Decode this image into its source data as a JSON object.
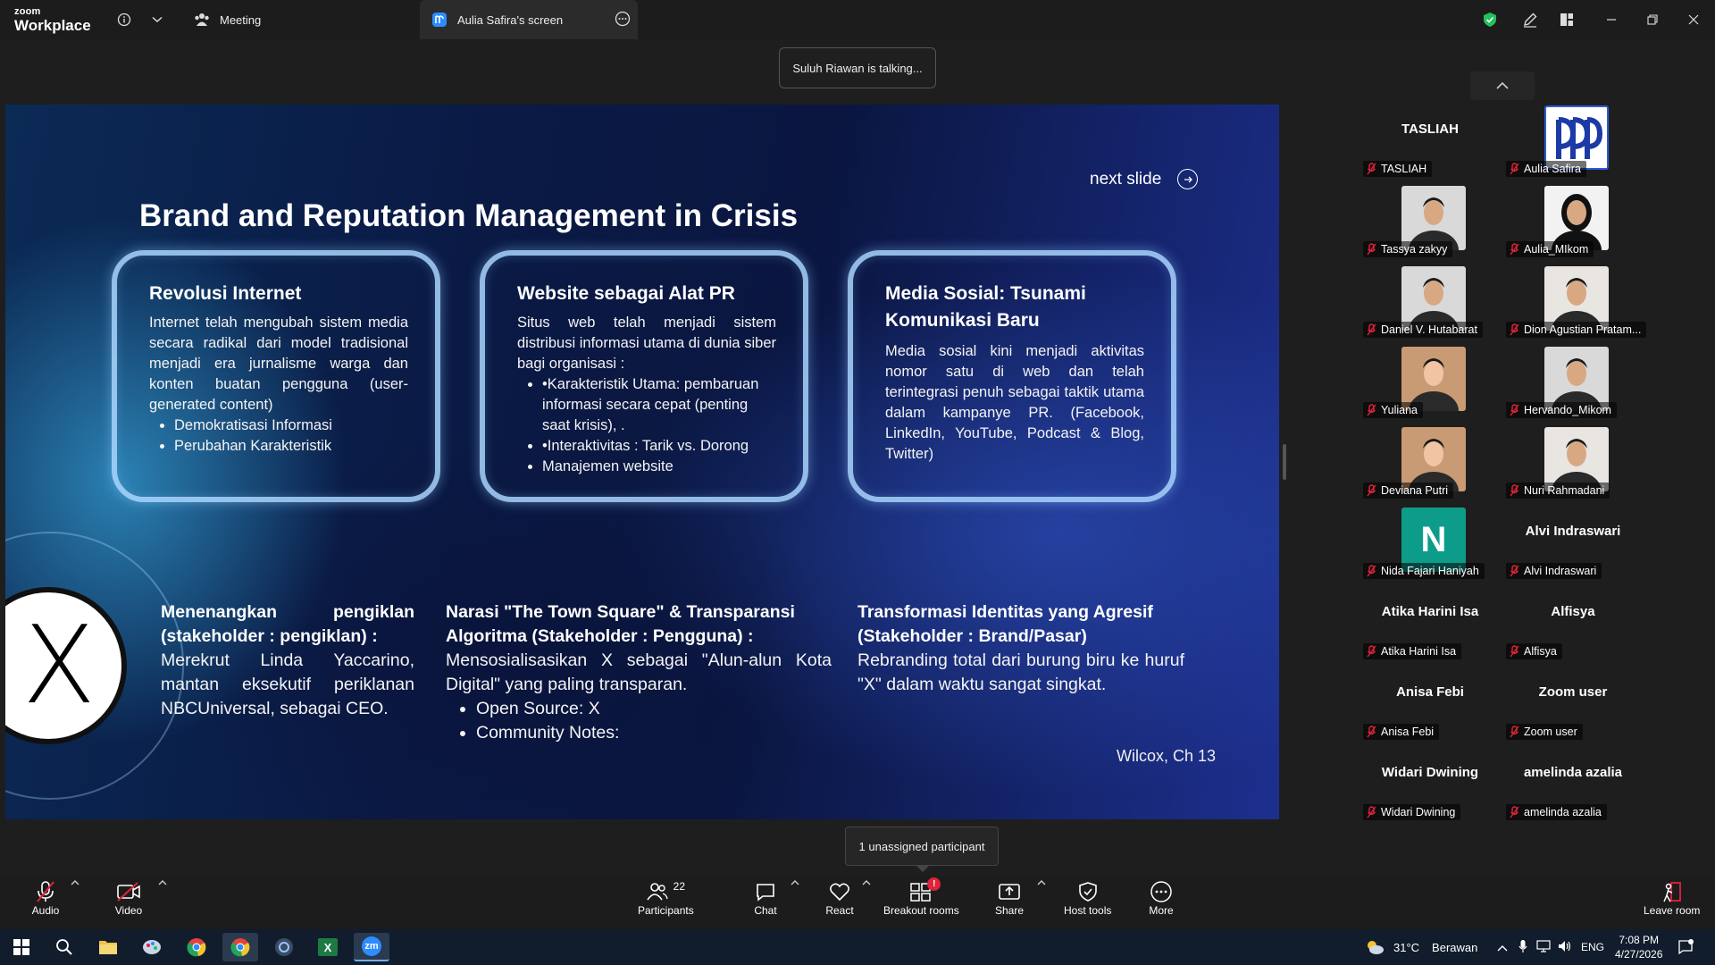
{
  "app": {
    "brand_small": "zoom",
    "brand_big": "Workplace",
    "tab_meeting": "Meeting",
    "tab_screen": "Aulia Safira's screen"
  },
  "stage": {
    "talking": "Suluh Riawan is talking...",
    "unassigned": "1 unassigned participant"
  },
  "slide": {
    "title": "Brand and Reputation Management in Crisis",
    "next": "next slide",
    "cards": [
      {
        "heading": "Revolusi Internet",
        "body": "Internet telah mengubah sistem media secara radikal dari model tradisional menjadi era jurnalisme warga dan konten buatan pengguna (user-generated content)",
        "bullets": [
          "Demokratisasi Informasi",
          "Perubahan Karakteristik"
        ]
      },
      {
        "heading": "Website sebagai Alat PR",
        "body": "Situs web telah menjadi sistem distribusi informasi utama di dunia siber bagi organisasi :",
        "bullets": [
          "•Karakteristik Utama: pembaruan informasi secara cepat (penting saat krisis), .",
          "•Interaktivitas : Tarik vs. Dorong",
          "Manajemen website"
        ]
      },
      {
        "heading": "Media Sosial:  Tsunami Komunikasi Baru",
        "body": "Media sosial kini menjadi aktivitas nomor satu di web dan telah terintegrasi penuh sebagai taktik utama dalam kampanye PR. (Facebook, LinkedIn, YouTube, Podcast & Blog, Twitter)",
        "bullets": []
      }
    ],
    "x_letter": "X",
    "cols": [
      {
        "heading": "Menenangkan pengiklan (stakeholder : pengiklan) :",
        "body": "Merekrut Linda Yaccarino, mantan eksekutif periklanan NBCUniversal, sebagai CEO.",
        "bullets": []
      },
      {
        "heading": "Narasi \"The Town Square\" & Transparansi Algoritma (Stakeholder : Pengguna) :",
        "body": "Mensosialisasikan X sebagai \"Alun-alun Kota Digital\" yang paling transparan.",
        "bullets": [
          "Open Source: X",
          "Community Notes:"
        ]
      },
      {
        "heading": "Transformasi Identitas yang Agresif (Stakeholder : Brand/Pasar)",
        "body": "Rebranding total dari burung biru ke huruf \"X\" dalam waktu sangat singkat.",
        "bullets": []
      }
    ],
    "footnote": "Wilcox, Ch 13"
  },
  "participants": [
    {
      "name": "TASLIAH",
      "big": "TASLIAH",
      "photo": "none"
    },
    {
      "name": "Aulia Safira",
      "big": "",
      "photo": "logo"
    },
    {
      "name": "Tassya zakyy",
      "big": "",
      "photo": "person"
    },
    {
      "name": "Aulia_MIkom",
      "big": "",
      "photo": "hijab"
    },
    {
      "name": "Daniel V. Hutabarat",
      "big": "",
      "photo": "person"
    },
    {
      "name": "Dion Agustian Pratam...",
      "big": "",
      "photo": "person-light"
    },
    {
      "name": "Yuliana",
      "big": "",
      "photo": "person-warm"
    },
    {
      "name": "Hervando_Mikom",
      "big": "",
      "photo": "person"
    },
    {
      "name": "Deviana Putri",
      "big": "",
      "photo": "person-warm"
    },
    {
      "name": "Nuri Rahmadani",
      "big": "",
      "photo": "person-light"
    },
    {
      "name": "Nida Fajari Haniyah",
      "big": "",
      "photo": "initial"
    },
    {
      "name": "Alvi Indraswari",
      "big": "Alvi Indraswari",
      "photo": "none"
    },
    {
      "name": "Atika Harini Isa",
      "big": "Atika Harini Isa",
      "photo": "none"
    },
    {
      "name": "Alfisya",
      "big": "Alfisya",
      "photo": "none"
    },
    {
      "name": "Anisa Febi",
      "big": "Anisa Febi",
      "photo": "none"
    },
    {
      "name": "Zoom user",
      "big": "Zoom user",
      "photo": "none"
    },
    {
      "name": "Widari Dwining",
      "big": "Widari Dwining",
      "photo": "none"
    },
    {
      "name": "amelinda azalia",
      "big": "amelinda azalia",
      "photo": "none"
    }
  ],
  "initial_letter": "N",
  "toolbar": {
    "audio": "Audio",
    "video": "Video",
    "participants": "Participants",
    "participants_count": "22",
    "chat": "Chat",
    "react": "React",
    "breakout": "Breakout rooms",
    "breakout_badge": "!",
    "share": "Share",
    "host_tools": "Host tools",
    "more": "More",
    "leave": "Leave room"
  },
  "taskbar": {
    "weather_temp": "31°C",
    "weather_text": "Berawan",
    "lang": "ENG",
    "time": "7:08 PM",
    "date": "4/27/2026",
    "excel_letter": "X",
    "zoom_letters": "zm"
  },
  "colors": {
    "zoom_blue": "#2d8cff",
    "mute_red": "#e0233a",
    "shield_green": "#23c15b",
    "initial_tile": "#0e9c8a"
  }
}
